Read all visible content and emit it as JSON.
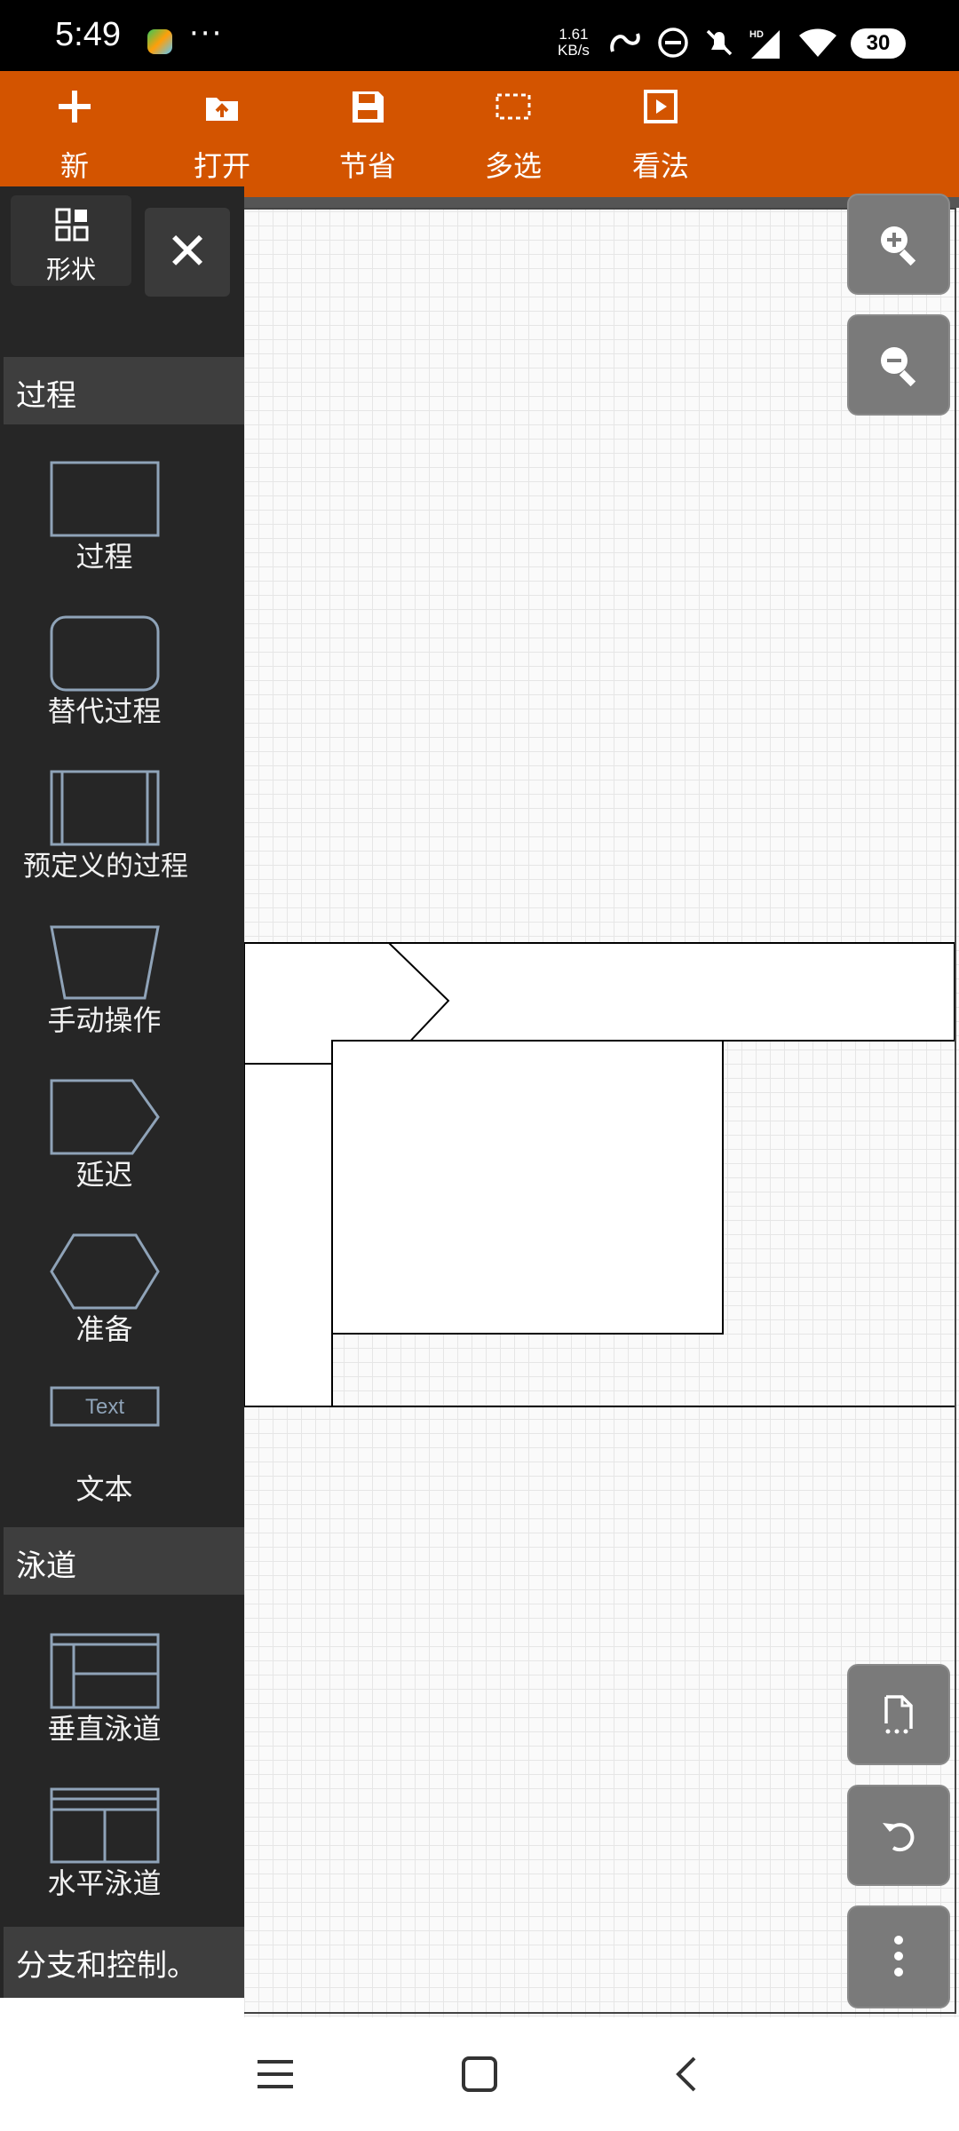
{
  "status_bar": {
    "time": "5:49",
    "more": "···",
    "net_speed_value": "1.61",
    "net_speed_unit": "KB/s",
    "battery": "30"
  },
  "toolbar": {
    "new": "新",
    "open": "打开",
    "save": "节省",
    "multi_select": "多选",
    "view": "看法"
  },
  "sidebar": {
    "shapes_label": "形状",
    "close_icon": "close-icon",
    "sections": [
      {
        "title": "过程",
        "items": [
          "过程",
          "替代过程",
          "预定义的过程",
          "手动操作",
          "延迟",
          "准备",
          "文本"
        ]
      },
      {
        "title": "泳道",
        "items": [
          "垂直泳道",
          "水平泳道"
        ]
      },
      {
        "title": "分支和控制。"
      }
    ],
    "text_shape_sample": "Text"
  },
  "accent_color": "#d35400",
  "sidebar_bg": "#262626",
  "right_buttons": [
    "zoom-in-icon",
    "zoom-out-icon",
    "page-icon",
    "undo-icon",
    "more-vertical-icon"
  ],
  "nav_bar": [
    "menu-icon",
    "home-icon",
    "back-icon"
  ]
}
